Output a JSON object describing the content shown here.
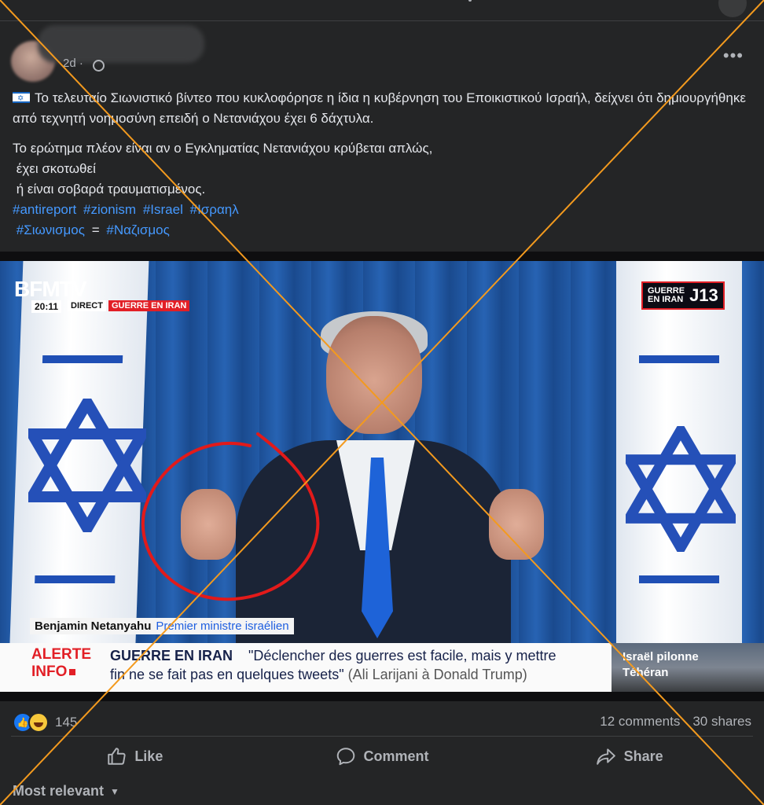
{
  "post": {
    "time": "2d ·",
    "more_label": "•••",
    "paragraph1": "Το τελευταίο Σιωνιστικό βίντεο που κυκλοφόρησε η ίδια η κυβέρνηση του Εποικιστικού Ισραήλ, δείχνει ότι δημιουργήθηκε από τεχνητή νοημοσύνη επειδή ο Νετανιάχου έχει 6 δάχτυλα.",
    "line1": "Το ερώτημα πλέον είναι αν ο Εγκληματίας Νετανιάχου κρύβεται απλώς,",
    "line2": "έχει σκοτωθεί",
    "line3": "ή είναι σοβαρά τραυματισμένος.",
    "hashtags1": [
      "#antireport",
      "#zionism",
      "#Israel",
      "#Ισραηλ"
    ],
    "hashtags2": [
      "#Σιωνισμος",
      "=",
      "#Ναζισμος"
    ]
  },
  "video": {
    "logo": "BFMTV",
    "clock": "20:11",
    "direct": "DIRECT",
    "guerre_tag": "GUERRE EN IRAN",
    "badge_text": "GUERRE\nEN IRAN",
    "badge_day": "J13",
    "name": "Benjamin Netanyahu",
    "role": "Premier ministre israélien",
    "alerte": "ALERTE",
    "info": "INFO",
    "ticker_head": "GUERRE EN IRAN",
    "quote_line1": "\"Déclencher des guerres est facile, mais y mettre",
    "quote_line2": "fin ne se fait pas en quelques tweets\"",
    "quote_source": "(Ali Larijani à Donald Trump)",
    "side_news": "Israël pilonne\nTéhéran"
  },
  "stats": {
    "reaction_count": "145",
    "comments": "12 comments",
    "shares": "30 shares"
  },
  "actions": {
    "like": "Like",
    "comment": "Comment",
    "share": "Share"
  },
  "sort": {
    "label": "Most relevant"
  },
  "colors": {
    "background": "#242526",
    "hashtag": "#4599ff",
    "cross": "#f39a1e",
    "alert_red": "#e21f26"
  }
}
